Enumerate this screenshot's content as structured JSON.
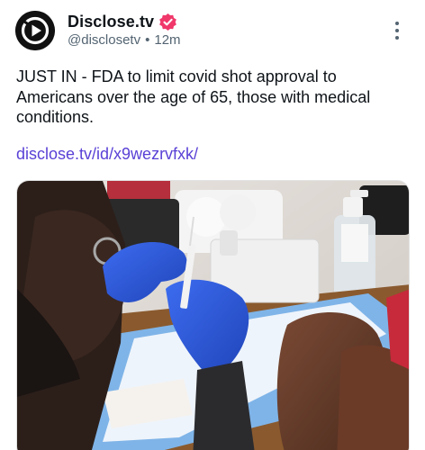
{
  "account": {
    "display_name": "Disclose.tv",
    "handle": "@disclosetv",
    "separator": "•",
    "time_ago": "12m"
  },
  "post": {
    "text": "JUST IN - FDA to limit covid shot approval to Americans over the age of 65, those with medical conditions.",
    "link": "disclose.tv/id/x9wezrvfxk/"
  },
  "icons": {
    "avatar": "play-logo-icon",
    "verified": "verified-badge-icon",
    "more": "more-vertical-icon"
  },
  "colors": {
    "link": "#5a41d6",
    "verified_badge": "#f0386b",
    "secondary_text": "#536471",
    "glove": "#2f5fd6"
  }
}
